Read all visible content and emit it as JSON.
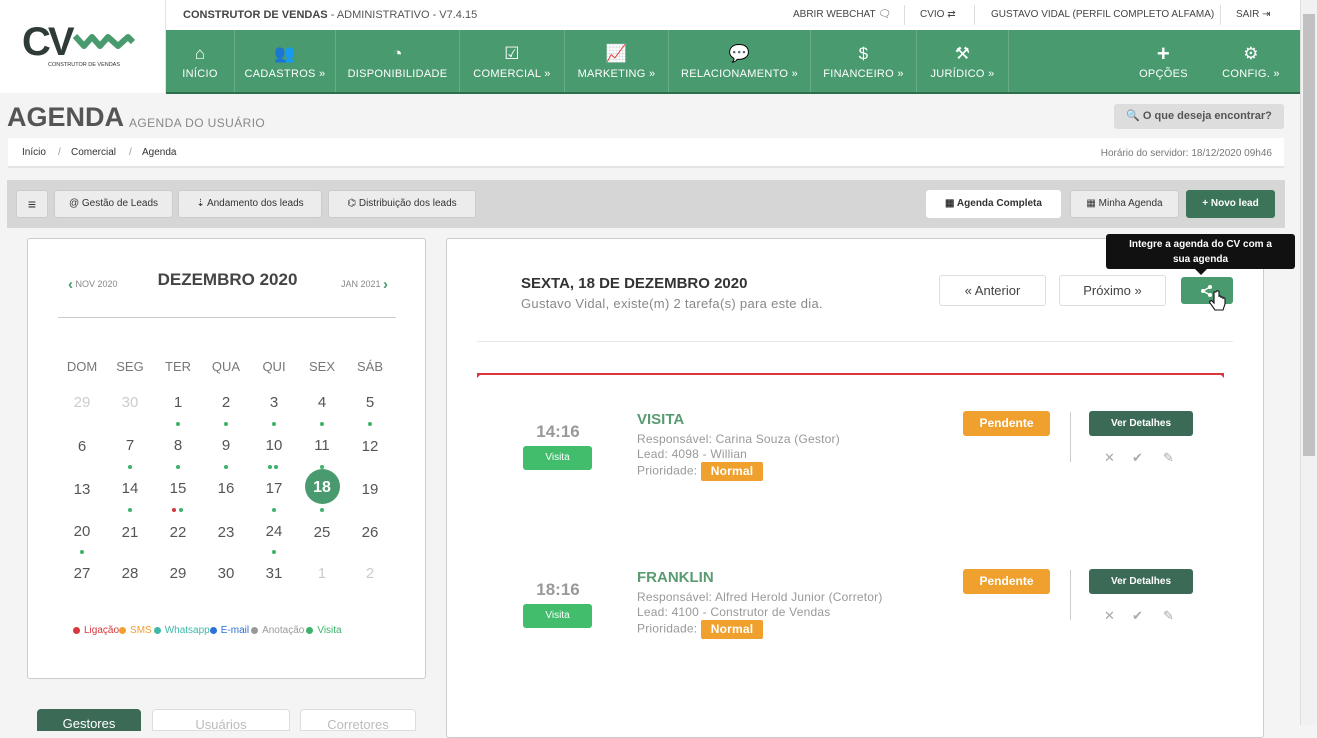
{
  "app": {
    "logo_text": "CV",
    "logo_caption": "CONSTRUTOR DE VENDAS",
    "name": "CONSTRUTOR DE VENDAS",
    "suffix": " - ADMINISTRATIVO - V7.4.15"
  },
  "topbar": {
    "webchat": "ABRIR WEBCHAT",
    "cvio": "CVIO",
    "user": "GUSTAVO VIDAL (PERFIL COMPLETO ALFAMA)",
    "logout": "SAIR"
  },
  "nav": {
    "items": [
      {
        "label": "INÍCIO",
        "icon": "home-icon"
      },
      {
        "label": "CADASTROS",
        "icon": "users-icon"
      },
      {
        "label": "DISPONIBILIDADE",
        "icon": "gauge-icon"
      },
      {
        "label": "COMERCIAL",
        "icon": "checkbox-icon"
      },
      {
        "label": "MARKETING",
        "icon": "chart-icon"
      },
      {
        "label": "RELACIONAMENTO",
        "icon": "chat-icon"
      },
      {
        "label": "FINANCEIRO",
        "icon": "dollar-icon"
      },
      {
        "label": "JURÍDICO",
        "icon": "gavel-icon"
      }
    ],
    "options": "OPÇÕES",
    "config": "CONFIG."
  },
  "page": {
    "title": "AGENDA",
    "subtitle": "AGENDA DO USUÁRIO",
    "search": "O que deseja encontrar?"
  },
  "breadcrumb": {
    "items": [
      "Início",
      "Comercial",
      "Agenda"
    ],
    "server_time": "Horário do servidor: 18/12/2020 09h46"
  },
  "toolbar": {
    "menu": "≡",
    "leads_management": "@ Gestão de Leads",
    "leads_progress": "Andamento dos leads",
    "leads_distribution": "Distribuição dos leads",
    "full_agenda": "Agenda Completa",
    "my_agenda": "Minha Agenda",
    "new_lead": "Novo lead"
  },
  "calendar": {
    "prev_month": "NOV 2020",
    "current_month": "DEZEMBRO 2020",
    "next_month": "JAN 2021",
    "weekdays": [
      "DOM",
      "SEG",
      "TER",
      "QUA",
      "QUI",
      "SEX",
      "SÁB"
    ],
    "weeks": [
      [
        "29",
        "30",
        "1",
        "2",
        "3",
        "4",
        "5"
      ],
      [
        "6",
        "7",
        "8",
        "9",
        "10",
        "11",
        "12"
      ],
      [
        "13",
        "14",
        "15",
        "16",
        "17",
        "18",
        "19"
      ],
      [
        "20",
        "21",
        "22",
        "23",
        "24",
        "25",
        "26"
      ],
      [
        "27",
        "28",
        "29",
        "30",
        "31",
        "1",
        "2"
      ]
    ],
    "selected_day": "18",
    "legend": [
      {
        "label": "Ligação",
        "color": "#d9363e"
      },
      {
        "label": "SMS",
        "color": "#f0a02d"
      },
      {
        "label": "Whatsapp",
        "color": "#3fb8a6"
      },
      {
        "label": "E-mail",
        "color": "#2e6fd8"
      },
      {
        "label": "Anotação",
        "color": "#999999"
      },
      {
        "label": "Visita",
        "color": "#3cb36a"
      }
    ],
    "tabs": [
      "Gestores",
      "Usuários",
      "Corretores"
    ]
  },
  "day": {
    "title": "SEXTA, 18 DE DEZEMBRO 2020",
    "subtitle": "Gustavo Vidal, existe(m) 2 tarefa(s) para este dia.",
    "prev": "« Anterior",
    "next": "Próximo »",
    "tooltip_line1": "Integre a agenda do CV com a",
    "tooltip_line2": "sua agenda"
  },
  "tasks": [
    {
      "time": "14:16",
      "type": "Visita",
      "title": "VISITA",
      "responsible": "Responsável: Carina Souza (Gestor)",
      "lead": "Lead: 4098 - Willian",
      "priority_label": "Prioridade:",
      "priority": "Normal",
      "status": "Pendente",
      "details": "Ver Detalhes"
    },
    {
      "time": "18:16",
      "type": "Visita",
      "title": "FRANKLIN",
      "responsible": "Responsável: Alfred Herold Junior (Corretor)",
      "lead": "Lead: 4100 - Construtor de Vendas",
      "priority_label": "Prioridade:",
      "priority": "Normal",
      "status": "Pendente",
      "details": "Ver Detalhes"
    }
  ]
}
